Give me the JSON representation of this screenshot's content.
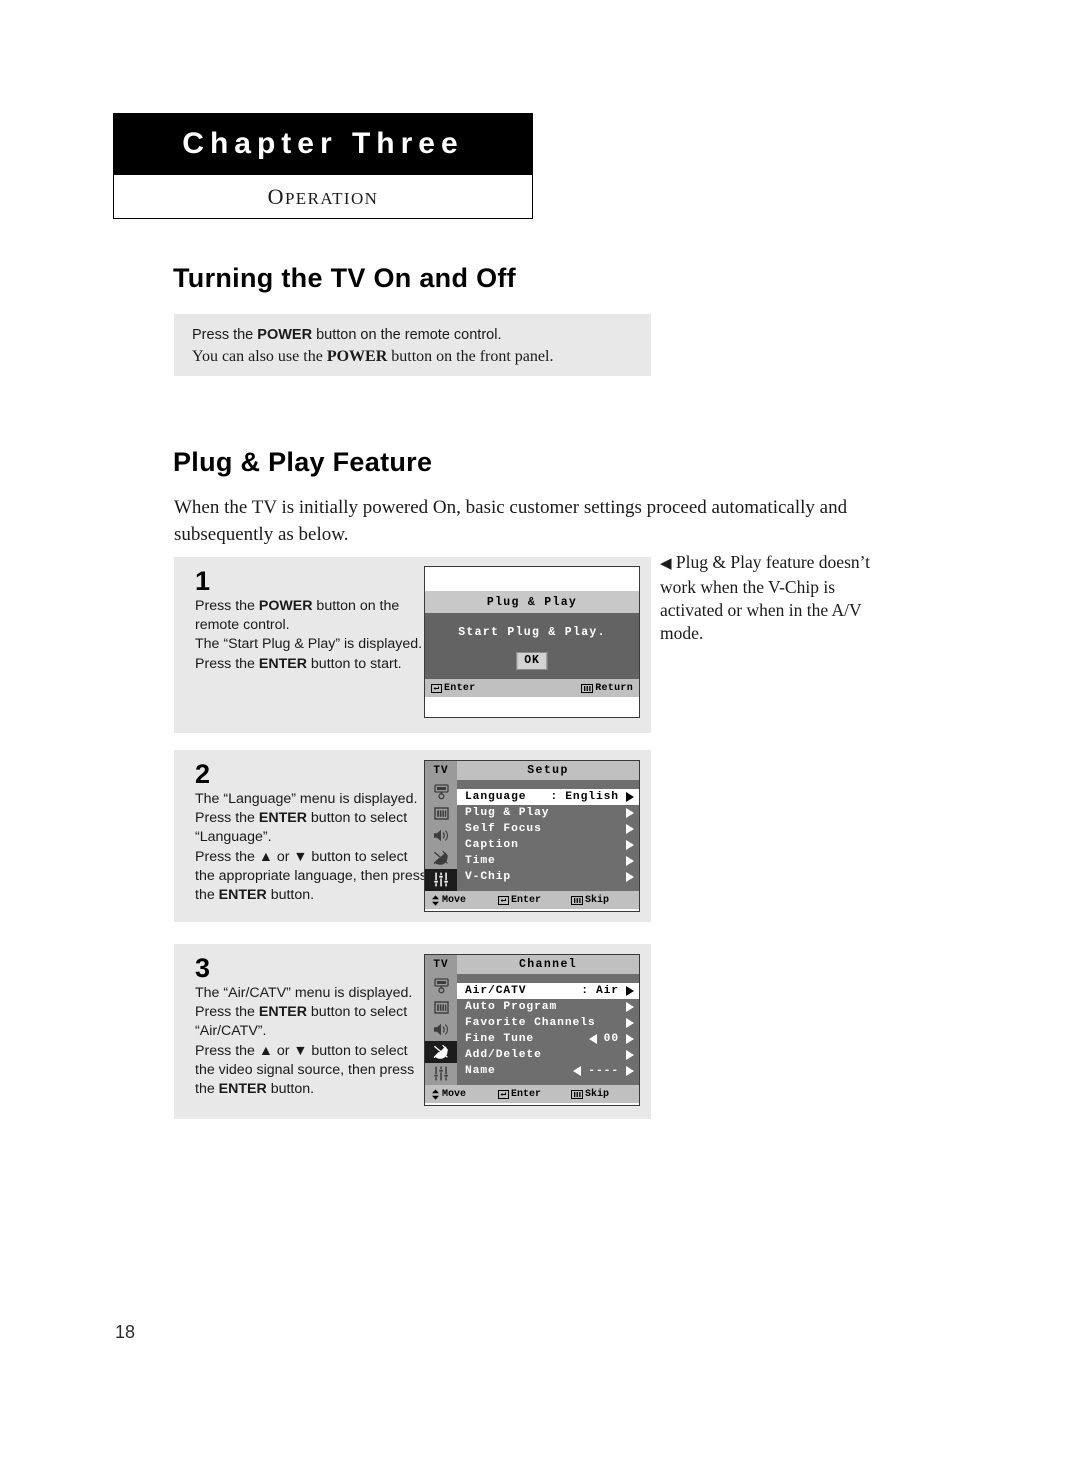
{
  "chapter": {
    "title": "Chapter Three",
    "subtitle_first": "O",
    "subtitle_rest": "PERATION"
  },
  "sections": {
    "turning_on_off": {
      "heading": "Turning the TV On and Off",
      "note_line1_pre": "Press the ",
      "note_line1_bold": "POWER",
      "note_line1_post": " button on the remote control.",
      "note_line2_pre": "You can also use the ",
      "note_line2_bold": "POWER",
      "note_line2_post": " button on the front panel."
    },
    "plug_and_play": {
      "heading": "Plug & Play Feature",
      "intro": "When the TV is initially powered On, basic customer settings proceed automatically and subsequently as below."
    }
  },
  "margin_note": {
    "marker": "◀",
    "text": "Plug & Play feature doesn’t work when the V-Chip is activated or when in the A/V mode."
  },
  "steps": [
    {
      "number": "1",
      "lines": [
        {
          "segments": [
            {
              "t": "Press the ",
              "b": false
            },
            {
              "t": "POWER",
              "b": true
            },
            {
              "t": " button on the",
              "b": false
            }
          ]
        },
        {
          "segments": [
            {
              "t": "remote control.",
              "b": false
            }
          ]
        },
        {
          "segments": [
            {
              "t": "The “Start Plug & Play” is displayed.",
              "b": false
            }
          ]
        },
        {
          "segments": [
            {
              "t": "Press the ",
              "b": false
            },
            {
              "t": "ENTER",
              "b": true
            },
            {
              "t": " button to start.",
              "b": false
            }
          ]
        }
      ]
    },
    {
      "number": "2",
      "lines": [
        {
          "segments": [
            {
              "t": "The “Language” menu is displayed.",
              "b": false
            }
          ]
        },
        {
          "segments": [
            {
              "t": "Press the ",
              "b": false
            },
            {
              "t": "ENTER",
              "b": true
            },
            {
              "t": " button to select",
              "b": false
            }
          ]
        },
        {
          "segments": [
            {
              "t": "“Language”.",
              "b": false
            }
          ]
        },
        {
          "segments": [
            {
              "t": "Press the ▲ or ▼ button to select",
              "b": false
            }
          ]
        },
        {
          "segments": [
            {
              "t": "the appropriate language, then press",
              "b": false
            }
          ]
        },
        {
          "segments": [
            {
              "t": "the ",
              "b": false
            },
            {
              "t": "ENTER",
              "b": true
            },
            {
              "t": " button.",
              "b": false
            }
          ]
        }
      ]
    },
    {
      "number": "3",
      "lines": [
        {
          "segments": [
            {
              "t": "The “Air/CATV” menu is displayed.",
              "b": false
            }
          ]
        },
        {
          "segments": [
            {
              "t": "Press the ",
              "b": false
            },
            {
              "t": "ENTER",
              "b": true
            },
            {
              "t": " button to select",
              "b": false
            }
          ]
        },
        {
          "segments": [
            {
              "t": "“Air/CATV”.",
              "b": false
            }
          ]
        },
        {
          "segments": [
            {
              "t": "Press the ▲ or ▼ button to select",
              "b": false
            }
          ]
        },
        {
          "segments": [
            {
              "t": "the video signal source, then press",
              "b": false
            }
          ]
        },
        {
          "segments": [
            {
              "t": "the ",
              "b": false
            },
            {
              "t": "ENTER",
              "b": true
            },
            {
              "t": " button.",
              "b": false
            }
          ]
        }
      ]
    }
  ],
  "osd_plug_play": {
    "title": "Plug & Play",
    "message": "Start Plug & Play.",
    "ok_label": "OK",
    "footer_left": "Enter",
    "footer_right": "Return",
    "footer_left_icon": "enter-key-icon",
    "footer_right_icon": "menu-bars-icon"
  },
  "osd_setup": {
    "tv_label": "TV",
    "title": "Setup",
    "active_icon_index": 5,
    "sidebar_icons": [
      "input-source-icon",
      "picture-bars-icon",
      "speaker-icon",
      "satellite-dish-icon",
      "sliders-icon"
    ],
    "rows": [
      {
        "label": "Language",
        "colon": ":",
        "value": "English",
        "selected": true,
        "left_arrow": false,
        "right_arrow": true
      },
      {
        "label": "Plug & Play",
        "colon": "",
        "value": "",
        "selected": false,
        "left_arrow": false,
        "right_arrow": true
      },
      {
        "label": "Self Focus",
        "colon": "",
        "value": "",
        "selected": false,
        "left_arrow": false,
        "right_arrow": true
      },
      {
        "label": "Caption",
        "colon": "",
        "value": "",
        "selected": false,
        "left_arrow": false,
        "right_arrow": true
      },
      {
        "label": "Time",
        "colon": "",
        "value": "",
        "selected": false,
        "left_arrow": false,
        "right_arrow": true
      },
      {
        "label": "V-Chip",
        "colon": "",
        "value": "",
        "selected": false,
        "left_arrow": false,
        "right_arrow": true
      }
    ],
    "footer": [
      {
        "icon": "up-down-arrow-icon",
        "label": "Move"
      },
      {
        "icon": "enter-key-icon",
        "label": "Enter"
      },
      {
        "icon": "menu-bars-icon",
        "label": "Skip"
      }
    ]
  },
  "osd_channel": {
    "tv_label": "TV",
    "title": "Channel",
    "active_icon_index": 4,
    "sidebar_icons": [
      "input-source-icon",
      "picture-bars-icon",
      "speaker-icon",
      "satellite-dish-icon",
      "sliders-icon"
    ],
    "rows": [
      {
        "label": "Air/CATV",
        "colon": ":",
        "value": "Air",
        "selected": true,
        "left_arrow": false,
        "right_arrow": true
      },
      {
        "label": "Auto Program",
        "colon": "",
        "value": "",
        "selected": false,
        "left_arrow": false,
        "right_arrow": true
      },
      {
        "label": "Favorite Channels",
        "colon": "",
        "value": "",
        "selected": false,
        "left_arrow": false,
        "right_arrow": true
      },
      {
        "label": "Fine Tune",
        "colon": "",
        "value": "00",
        "selected": false,
        "left_arrow": true,
        "right_arrow": true
      },
      {
        "label": "Add/Delete",
        "colon": "",
        "value": "",
        "selected": false,
        "left_arrow": false,
        "right_arrow": true
      },
      {
        "label": "Name",
        "colon": "",
        "value": "----",
        "selected": false,
        "left_arrow": true,
        "right_arrow": true
      }
    ],
    "footer": [
      {
        "icon": "up-down-arrow-icon",
        "label": "Move"
      },
      {
        "icon": "enter-key-icon",
        "label": "Enter"
      },
      {
        "icon": "menu-bars-icon",
        "label": "Skip"
      }
    ]
  },
  "page_number": "18",
  "colors": {
    "panel_gray": "#e8e8e8",
    "osd_body_dark": "#636363",
    "osd_menu_body": "#6e6e6e",
    "osd_bar_light": "#c0c0c0",
    "osd_sidebar": "#9a9a9a",
    "active_black": "#1c1c1c"
  }
}
